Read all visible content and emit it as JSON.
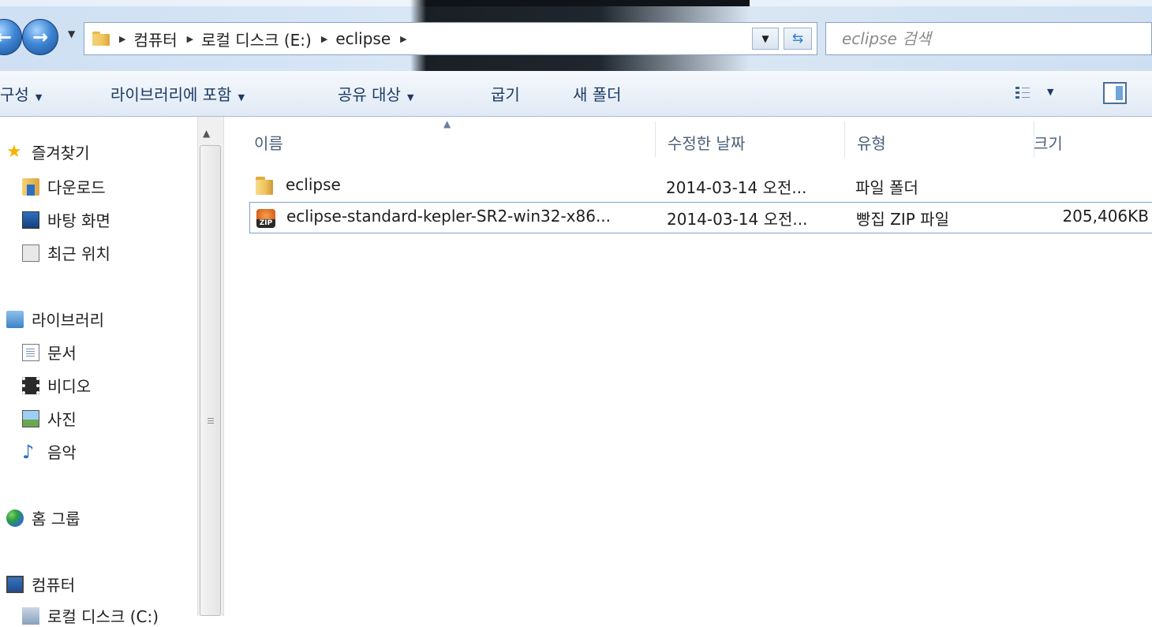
{
  "breadcrumb": {
    "items": [
      "컴퓨터",
      "로컬 디스크 (E:)",
      "eclipse"
    ]
  },
  "search": {
    "placeholder": "eclipse 검색"
  },
  "toolbar": {
    "organize": "구성",
    "include_library": "라이브러리에 포함",
    "share_with": "공유 대상",
    "burn": "굽기",
    "new_folder": "새 폴더"
  },
  "nav": {
    "favorites": "즐겨찾기",
    "downloads": "다운로드",
    "desktop": "바탕 화면",
    "recent": "최근 위치",
    "libraries": "라이브러리",
    "documents": "문서",
    "videos": "비디오",
    "pictures": "사진",
    "music": "음악",
    "homegroup": "홈 그룹",
    "computer": "컴퓨터",
    "local_c": "로컬 디스크 (C:)"
  },
  "columns": {
    "name": "이름",
    "date": "수정한 날짜",
    "type": "유형",
    "size": "크기"
  },
  "files": [
    {
      "name": "eclipse",
      "date": "2014-03-14 오전...",
      "type": "파일 폴더",
      "size": "",
      "icon": "folder-icon"
    },
    {
      "name": "eclipse-standard-kepler-SR2-win32-x86...",
      "date": "2014-03-14 오전...",
      "type": "빵집 ZIP 파일",
      "size": "205,406KB",
      "icon": "zip-icon"
    }
  ],
  "icons": {
    "zip_badge": "ZIP"
  },
  "colors": {
    "accent": "#2b6fc4",
    "selection_border": "#7da2ce",
    "header_text": "#4c607a"
  }
}
